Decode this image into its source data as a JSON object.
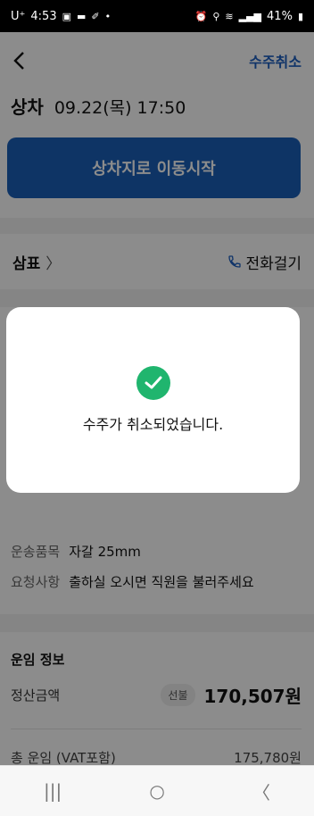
{
  "status_bar": {
    "time": "4:53",
    "carrier": "U⁺",
    "battery": "41%",
    "icons": [
      "message-icon",
      "chat-icon",
      "brush-icon",
      "dot-icon",
      "alarm-icon",
      "location-icon",
      "wifi-icon",
      "signal-icon",
      "battery-icon"
    ]
  },
  "header": {
    "back_icon": "chevron-left-icon",
    "cancel_label": "수주취소"
  },
  "pickup": {
    "title": "상차",
    "datetime": "09.22(목) 17:50"
  },
  "start_button": {
    "label": "상차지로 이동시작"
  },
  "company": {
    "name": "삼표",
    "chevron": "〉",
    "call_label": "전화걸기",
    "call_icon": "phone-icon"
  },
  "details": [
    {
      "label": "운송품목",
      "value": "자갈 25mm"
    },
    {
      "label": "요청사항",
      "value": "출하실 오시면 직원을 불러주세요"
    }
  ],
  "fare": {
    "title": "운임 정보",
    "settlement_label": "정산금액",
    "badge": "선불",
    "settlement_amount": "170,507원",
    "total_label": "총 운임 (VAT포함)",
    "total_amount": "175,780원"
  },
  "dialog": {
    "icon": "check-circle-icon",
    "message": "수주가 취소되었습니다.",
    "check_color": "#20b56e"
  },
  "nav_bar": {
    "recents": "|||",
    "home": "○",
    "back": "〈"
  },
  "colors": {
    "accent": "#1a5fb8",
    "link": "#1e5fbf"
  }
}
